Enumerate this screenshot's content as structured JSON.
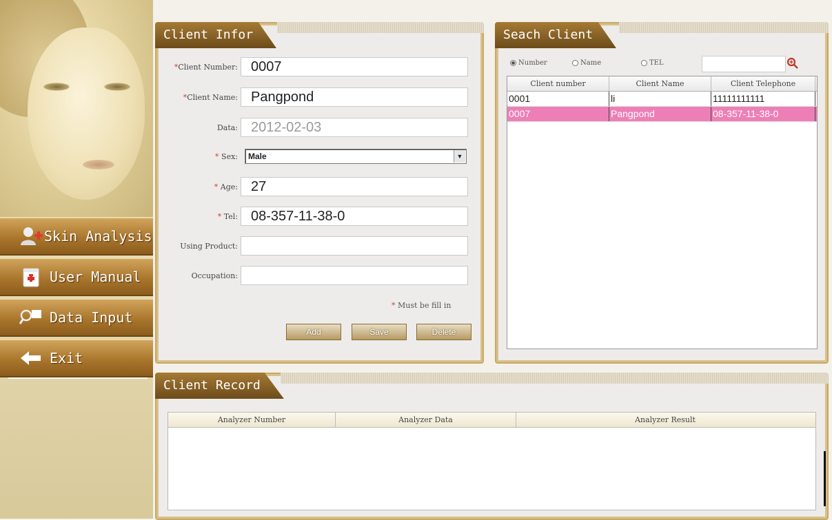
{
  "sidebar": {
    "nav": [
      {
        "label": "Skin Analysis",
        "icon": "user-add-icon"
      },
      {
        "label": "User Manual",
        "icon": "manual-book-icon"
      },
      {
        "label": "Data Input",
        "icon": "search-icon"
      },
      {
        "label": "Exit",
        "icon": "arrow-left-icon"
      }
    ]
  },
  "client_info": {
    "title": "Client Infor",
    "fields": {
      "number": {
        "label": "Client Number:",
        "required": true,
        "value": "0007"
      },
      "name": {
        "label": "Client Name:",
        "required": true,
        "value": "Pangpond"
      },
      "date": {
        "label": "Data:",
        "required": false,
        "value": "2012-02-03"
      },
      "sex": {
        "label": "Sex:",
        "required": true,
        "value": "Male"
      },
      "age": {
        "label": "Age:",
        "required": true,
        "value": "27"
      },
      "tel": {
        "label": "Tel:",
        "required": true,
        "value": "08-357-11-38-0"
      },
      "product": {
        "label": "Using Product:",
        "required": false,
        "value": ""
      },
      "occupation": {
        "label": "Occupation:",
        "required": false,
        "value": ""
      }
    },
    "required_star": "*",
    "must_note": "Must be fill in",
    "buttons": {
      "add": "Add",
      "save": "Save",
      "delete": "Delete"
    }
  },
  "search_client": {
    "title": "Seach Client",
    "radios": [
      {
        "label": "Number",
        "selected": true
      },
      {
        "label": "Name",
        "selected": false
      },
      {
        "label": "TEL",
        "selected": false
      }
    ],
    "search_value": "",
    "columns": [
      "Client number",
      "Client Name",
      "Client Telephone"
    ],
    "rows": [
      {
        "number": "0001",
        "name": "li",
        "tel": "11111111111",
        "selected": false
      },
      {
        "number": "0007",
        "name": "Pangpond",
        "tel": "08-357-11-38-0",
        "selected": true
      }
    ],
    "selection_color": "#ee7fb6"
  },
  "client_record": {
    "title": "Client Record",
    "columns": [
      "Analyzer Number",
      "Analyzer Data",
      "Analyzer Result"
    ],
    "rows": []
  },
  "theme": {
    "accent": "#a9762c",
    "panel_border": "#c9a866",
    "required": "#d2403a"
  }
}
